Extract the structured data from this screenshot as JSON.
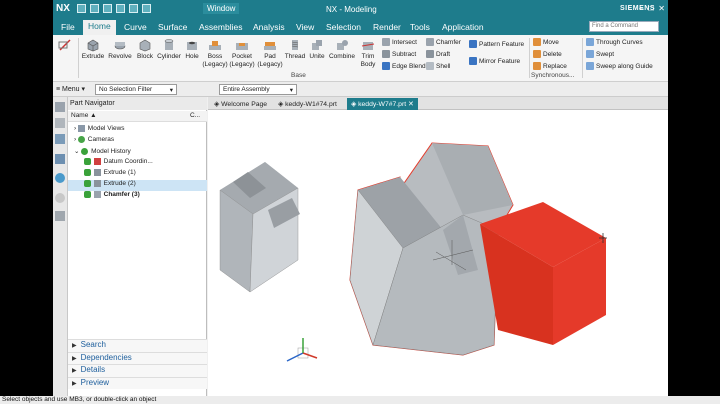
{
  "titlebar": {
    "logo": "NX",
    "window_menu": "Window",
    "title": "NX - Modeling",
    "brand": "SIEMENS",
    "controls": [
      "–",
      "□",
      "✕"
    ]
  },
  "menu_tabs": [
    "File",
    "Home",
    "Curve",
    "Surface",
    "Assemblies",
    "Analysis",
    "View",
    "Selection",
    "Render",
    "Tools",
    "Application"
  ],
  "command_finder": {
    "placeholder": "Find a Command"
  },
  "ribbon": {
    "buttons": [
      "Extrude",
      "Revolve",
      "Block",
      "Cylinder",
      "Hole",
      "Boss\n(Legacy)",
      "Pocket\n(Legacy)",
      "Pad\n(Legacy)",
      "Thread",
      "Unite",
      "Combine",
      "Trim\nBody"
    ],
    "small_col1": [
      "Intersect",
      "Subtract",
      "Edge Blend"
    ],
    "small_col2": [
      "Chamfer",
      "Draft",
      "Shell"
    ],
    "small_col3": [
      "Pattern Feature",
      "Mirror Feature"
    ],
    "small_col4": [
      "Move",
      "Delete",
      "Replace"
    ],
    "small_col5": [
      "Through Curves",
      "Swept",
      "Sweep along Guide"
    ],
    "group_base": "Base",
    "group_synchronous": "Synchronous..."
  },
  "selection_bar": {
    "menu": "Menu",
    "filter": "No Selection Filter",
    "scope": "Entire Assembly"
  },
  "navigator": {
    "title": "Part Navigator",
    "col_name": "Name",
    "col_c": "C...",
    "nodes": [
      {
        "label": "Model Views",
        "indent": 1
      },
      {
        "label": "Cameras",
        "indent": 1
      },
      {
        "label": "Model History",
        "indent": 1
      },
      {
        "label": "Datum Coordin...",
        "indent": 2
      },
      {
        "label": "Extrude (1)",
        "indent": 2
      },
      {
        "label": "Extrude (2)",
        "indent": 2
      },
      {
        "label": "Chamfer (3)",
        "indent": 2
      }
    ],
    "sections": [
      "Search",
      "Dependencies",
      "Details",
      "Preview"
    ]
  },
  "doc_tabs": [
    "Welcome Page",
    "keddy-W1#74.prt",
    "keddy-W7#7.prt"
  ],
  "status_text": "Select objects and use MB3, or double-click an object",
  "colors": {
    "accent": "#1e7c8c",
    "highlight": "#e53a2a",
    "body": "#b8bcc0"
  }
}
